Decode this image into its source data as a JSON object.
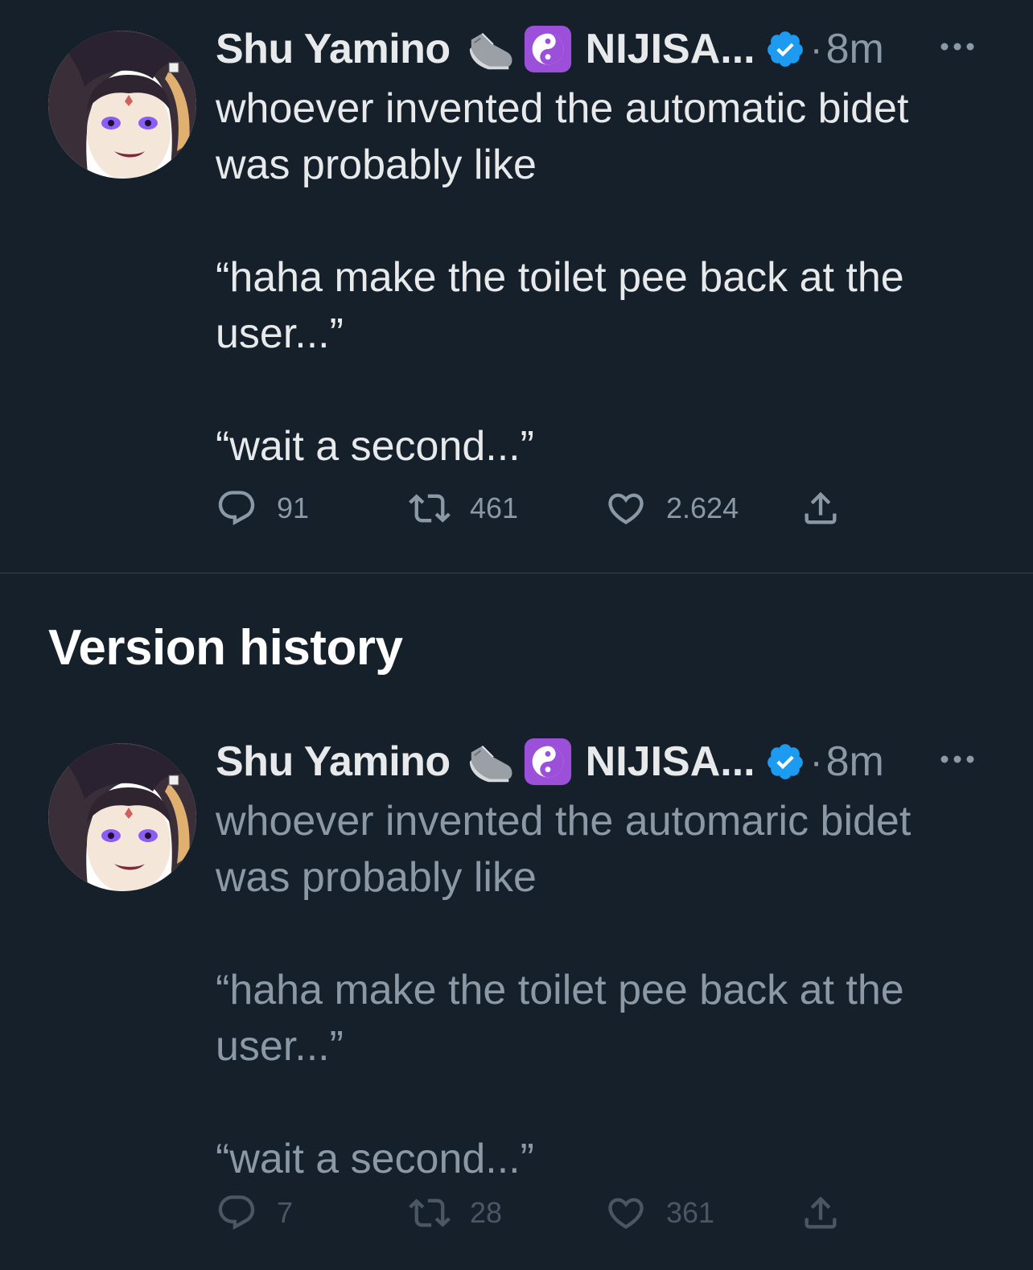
{
  "colors": {
    "background": "#15202b",
    "text_primary": "#e7e9ea",
    "text_secondary": "#8b98a5",
    "verified_blue": "#1d9bf0",
    "yin_yang_purple": "#9c4fd8"
  },
  "tweet": {
    "display_name": "Shu Yamino",
    "emoji_1": "sneaker-emoji",
    "emoji_2": "yin-yang-emoji",
    "affiliation": "NIJISA...",
    "separator": "·",
    "time": "8m",
    "lines": [
      "whoever invented the automatic bidet",
      "was probably like",
      "",
      "“haha make the toilet pee back at the",
      "user...”",
      "",
      "“wait a second...”"
    ],
    "replies": "91",
    "retweets": "461",
    "likes": "2.624"
  },
  "version_history": {
    "title": "Version history"
  },
  "old_tweet": {
    "display_name": "Shu Yamino",
    "affiliation": "NIJISA...",
    "separator": "·",
    "time": "8m",
    "lines": [
      "whoever invented the automaric bidet",
      "was probably like",
      "",
      "“haha make the toilet pee back at the",
      "user...”",
      "",
      "“wait a second...”"
    ],
    "replies": "7",
    "retweets": "28",
    "likes": "361"
  }
}
